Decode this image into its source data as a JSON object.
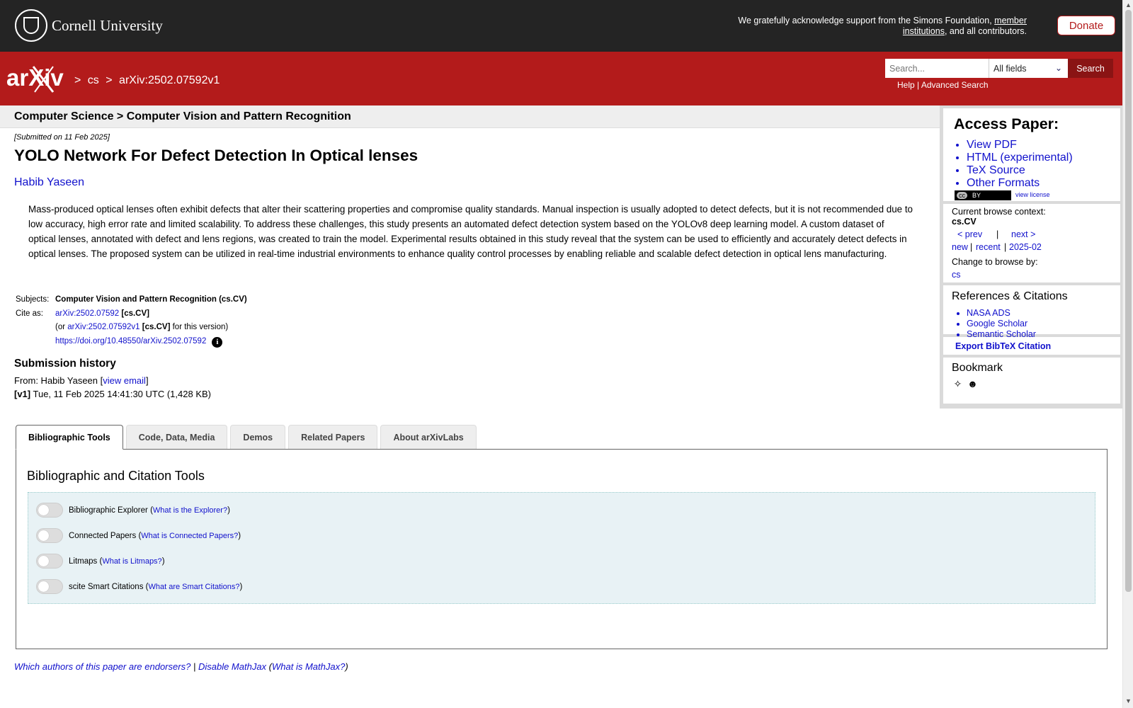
{
  "topbar": {
    "logo_text": "Cornell University",
    "ack_prefix": "We gratefully acknowledge support from the Simons Foundation,",
    "ack_link": "member institutions",
    "ack_suffix": ", and all contributors.",
    "donate_label": "Donate"
  },
  "header": {
    "logo_text": "arXiv",
    "crumbs": [
      ">",
      "cs",
      ">",
      "arXiv:2502.07592v1"
    ],
    "search_placeholder": "Search...",
    "search_field": "All fields",
    "search_button": "Search",
    "help_link": "Help",
    "separator": "|",
    "advanced_link": "Advanced Search"
  },
  "paper": {
    "category_header": "Computer Science > Computer Vision and Pattern Recognition",
    "submitted": "[Submitted on 11 Feb 2025]",
    "title": "YOLO Network For Defect Detection In Optical lenses",
    "author": "Habib Yaseen",
    "abstract": "Mass-produced optical lenses often exhibit defects that alter their scattering properties and compromise quality standards. Manual inspection is usually adopted to detect defects, but it is not recommended due to low accuracy, high error rate and limited scalability. To address these challenges, this study presents an automated defect detection system based on the YOLOv8 deep learning model. A custom dataset of optical lenses, annotated with defect and lens regions, was created to train the model. Experimental results obtained in this study reveal that the system can be used to efficiently and accurately detect defects in optical lenses. The proposed system can be utilized in real-time industrial environments to enhance quality control processes by enabling reliable and scalable defect detection in optical lens manufacturing.",
    "subjects_label": "Subjects:",
    "subjects": "Computer Vision and Pattern Recognition (cs.CV)",
    "cite_label": "Cite as:",
    "cite_id": "arXiv:2502.07592",
    "cite_cat": "[cs.CV]",
    "cite_or": "(or",
    "cite_version_id": "arXiv:2502.07592v1",
    "cite_version_cat": "[cs.CV]",
    "cite_version_suffix": "for this version)",
    "doi": "https://doi.org/10.48550/arXiv.2502.07592",
    "info_glyph": "i"
  },
  "history": {
    "title": "Submission history",
    "from_prefix": "From: Habib Yaseen [",
    "view_email": "view email",
    "from_suffix": "]",
    "v1_label": "[v1]",
    "v1_text": "Tue, 11 Feb 2025 14:41:30 UTC (1,428 KB)"
  },
  "sidebar": {
    "access_title": "Access Paper:",
    "access_links": [
      "View PDF",
      "HTML (experimental)",
      "TeX Source",
      "Other Formats"
    ],
    "license_badge": "BY",
    "license_cc": "cc",
    "view_license": "view license",
    "context_label": "Current browse context:",
    "context_value": "cs.CV",
    "prev": "< prev",
    "pipe": "|",
    "next": "next >",
    "new": "new",
    "recent": "recent",
    "month": "2025-02",
    "change_label": "Change to browse by:",
    "change_value": "cs",
    "refs_title": "References & Citations",
    "refs_links": [
      "NASA ADS",
      "Google Scholar",
      "Semantic Scholar"
    ],
    "bibtex": "Export BibTeX Citation",
    "bookmark_title": "Bookmark",
    "bookmark_icons": [
      "bibsonomy-icon",
      "reddit-icon"
    ]
  },
  "tabs": [
    "Bibliographic Tools",
    "Code, Data, Media",
    "Demos",
    "Related Papers",
    "About arXivLabs"
  ],
  "panel": {
    "title": "Bibliographic and Citation Tools",
    "tools": [
      {
        "label": "Bibliographic Explorer",
        "link": "What is the Explorer?"
      },
      {
        "label": "Connected Papers",
        "link": "What is Connected Papers?"
      },
      {
        "label": "Litmaps",
        "link": "What is Litmaps?"
      },
      {
        "label": "scite Smart Citations",
        "link": "What are Smart Citations?"
      }
    ]
  },
  "footer": {
    "endorsers": "Which authors of this paper are endorsers?",
    "sep": "|",
    "mathjax": "Disable MathJax",
    "mathjax_info": "What is MathJax?"
  },
  "colors": {
    "brand_red": "#b31b1b",
    "topbar": "#242424",
    "link": "#1111cc"
  }
}
